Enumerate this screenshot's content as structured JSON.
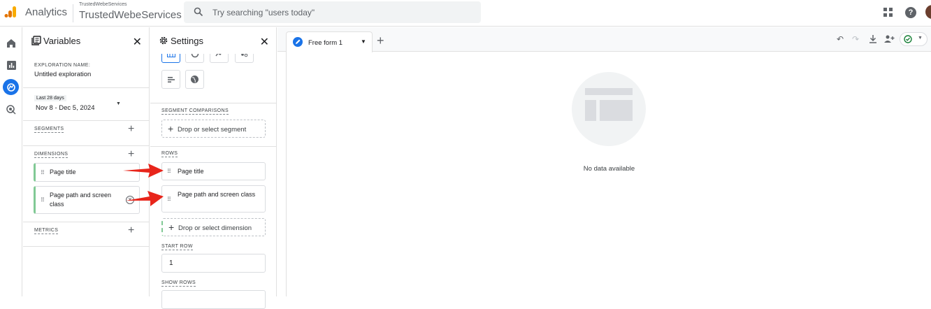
{
  "header": {
    "app_name": "Analytics",
    "property_account": "TrustedWebeServices",
    "property_name": "TrustedWebeServices",
    "search_placeholder": "Try searching \"users today\"",
    "icons": [
      "apps-grid-icon",
      "help-icon",
      "account-avatar"
    ]
  },
  "rail": {
    "items": [
      "home-icon",
      "reports-icon",
      "explore-icon",
      "advertising-icon"
    ],
    "active": "explore-icon"
  },
  "variables": {
    "title": "Variables",
    "exploration_name_label": "EXPLORATION NAME:",
    "exploration_name": "Untitled exploration",
    "date_badge": "Last 28 days",
    "date_range": "Nov 8 - Dec 5, 2024",
    "segments_label": "SEGMENTS",
    "dimensions_label": "DIMENSIONS",
    "dimensions": [
      "Page title",
      "Page path and screen class"
    ],
    "metrics_label": "METRICS"
  },
  "settings": {
    "title": "Settings",
    "segment_comparisons_label": "SEGMENT COMPARISONS",
    "segment_drop": "Drop or select segment",
    "rows_label": "ROWS",
    "rows": [
      "Page title",
      "Page path and screen class"
    ],
    "dimension_drop": "Drop or select dimension",
    "start_row_label": "START ROW",
    "start_row_value": "1",
    "show_rows_label": "SHOW ROWS"
  },
  "canvas": {
    "tab_label": "Free form 1",
    "empty_message": "No data available"
  },
  "colors": {
    "accent": "#1a73e8",
    "chip_border": "#81c995",
    "annotation_arrow": "#e8251b",
    "logo_orange": "#f9ab00",
    "logo_dark_orange": "#e37400"
  }
}
